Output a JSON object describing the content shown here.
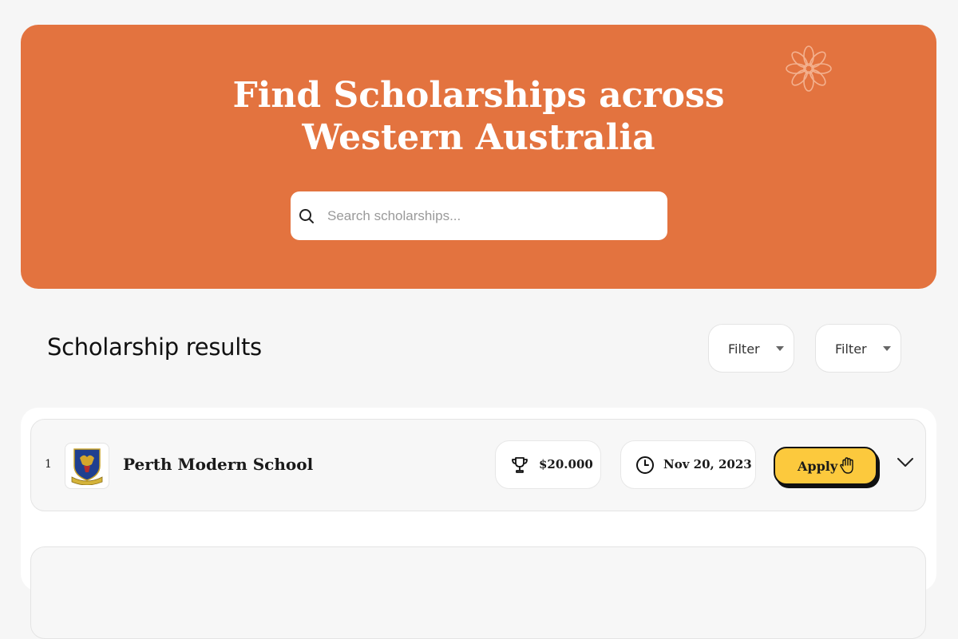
{
  "hero": {
    "title_line1": "Find Scholarships across",
    "title_line2": "Western Australia",
    "background_color": "#e3733f",
    "decoration_icon": "flower-icon"
  },
  "search": {
    "placeholder": "Search scholarships...",
    "value": "",
    "icon": "search-icon"
  },
  "results": {
    "title": "Scholarship results",
    "filters": [
      {
        "label": "Filter",
        "icon": "caret-down-icon"
      },
      {
        "label": "Filter",
        "icon": "caret-down-icon"
      }
    ]
  },
  "scholarships": [
    {
      "rank": "1",
      "school": "Perth Modern School",
      "logo": "school-crest-icon",
      "amount": "$20.000",
      "amount_icon": "trophy-icon",
      "deadline": "Nov 20, 2023",
      "deadline_icon": "clock-icon",
      "apply_label": "Apply",
      "apply_icon": "hand-icon",
      "expand_icon": "chevron-down-icon"
    }
  ],
  "colors": {
    "accent": "#e3733f",
    "apply_button": "#fcc93d",
    "page_background": "#f6f6f6"
  }
}
